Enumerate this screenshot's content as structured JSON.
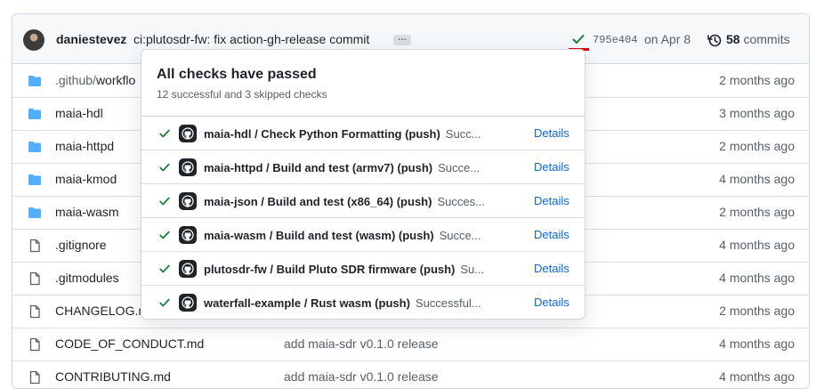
{
  "commit": {
    "author": "daniestevez",
    "message": "ci:plutosdr-fw: fix action-gh-release commit",
    "ellipsis": "…",
    "sha": "795e404",
    "date": "on Apr 8",
    "count": "58",
    "count_label": "commits",
    "status_color": "#1a7f37"
  },
  "files": [
    {
      "name": ".github/",
      "name_dim": "workflo",
      "type": "folder",
      "message": "",
      "age": "2 months ago"
    },
    {
      "name": "maia-hdl",
      "type": "folder",
      "message": "",
      "age": "3 months ago"
    },
    {
      "name": "maia-httpd",
      "type": "folder",
      "message": "",
      "age": "2 months ago"
    },
    {
      "name": "maia-kmod",
      "type": "folder",
      "message": "",
      "age": "4 months ago"
    },
    {
      "name": "maia-wasm",
      "type": "folder",
      "message": "",
      "age": "2 months ago"
    },
    {
      "name": ".gitignore",
      "type": "file",
      "message": "",
      "age": "4 months ago"
    },
    {
      "name": ".gitmodules",
      "type": "file",
      "message": "",
      "age": "4 months ago"
    },
    {
      "name": "CHANGELOG.m",
      "type": "file",
      "message": "",
      "age": "2 months ago"
    },
    {
      "name": "CODE_OF_CONDUCT.md",
      "type": "file",
      "message": "add maia-sdr v0.1.0 release",
      "age": "4 months ago"
    },
    {
      "name": "CONTRIBUTING.md",
      "type": "file",
      "message": "add maia-sdr v0.1.0 release",
      "age": "4 months ago"
    }
  ],
  "popover": {
    "title": "All checks have passed",
    "subtitle": "12 successful and 3 skipped checks",
    "checks": [
      {
        "name": "maia-hdl / Check Python Formatting (push)",
        "status": "Succ...",
        "details": "Details"
      },
      {
        "name": "maia-httpd / Build and test (armv7) (push)",
        "status": "Succe...",
        "details": "Details"
      },
      {
        "name": "maia-json / Build and test (x86_64) (push)",
        "status": "Succes...",
        "details": "Details"
      },
      {
        "name": "maia-wasm / Build and test (wasm) (push)",
        "status": "Succe...",
        "details": "Details"
      },
      {
        "name": "plutosdr-fw / Build Pluto SDR firmware (push)",
        "status": "Su...",
        "details": "Details"
      },
      {
        "name": "waterfall-example / Rust wasm (push)",
        "status": "Successful...",
        "details": "Details"
      }
    ]
  },
  "colors": {
    "accent": "#0969da",
    "success": "#1a7f37",
    "folder": "#54aeff",
    "highlight": "#e00000"
  }
}
